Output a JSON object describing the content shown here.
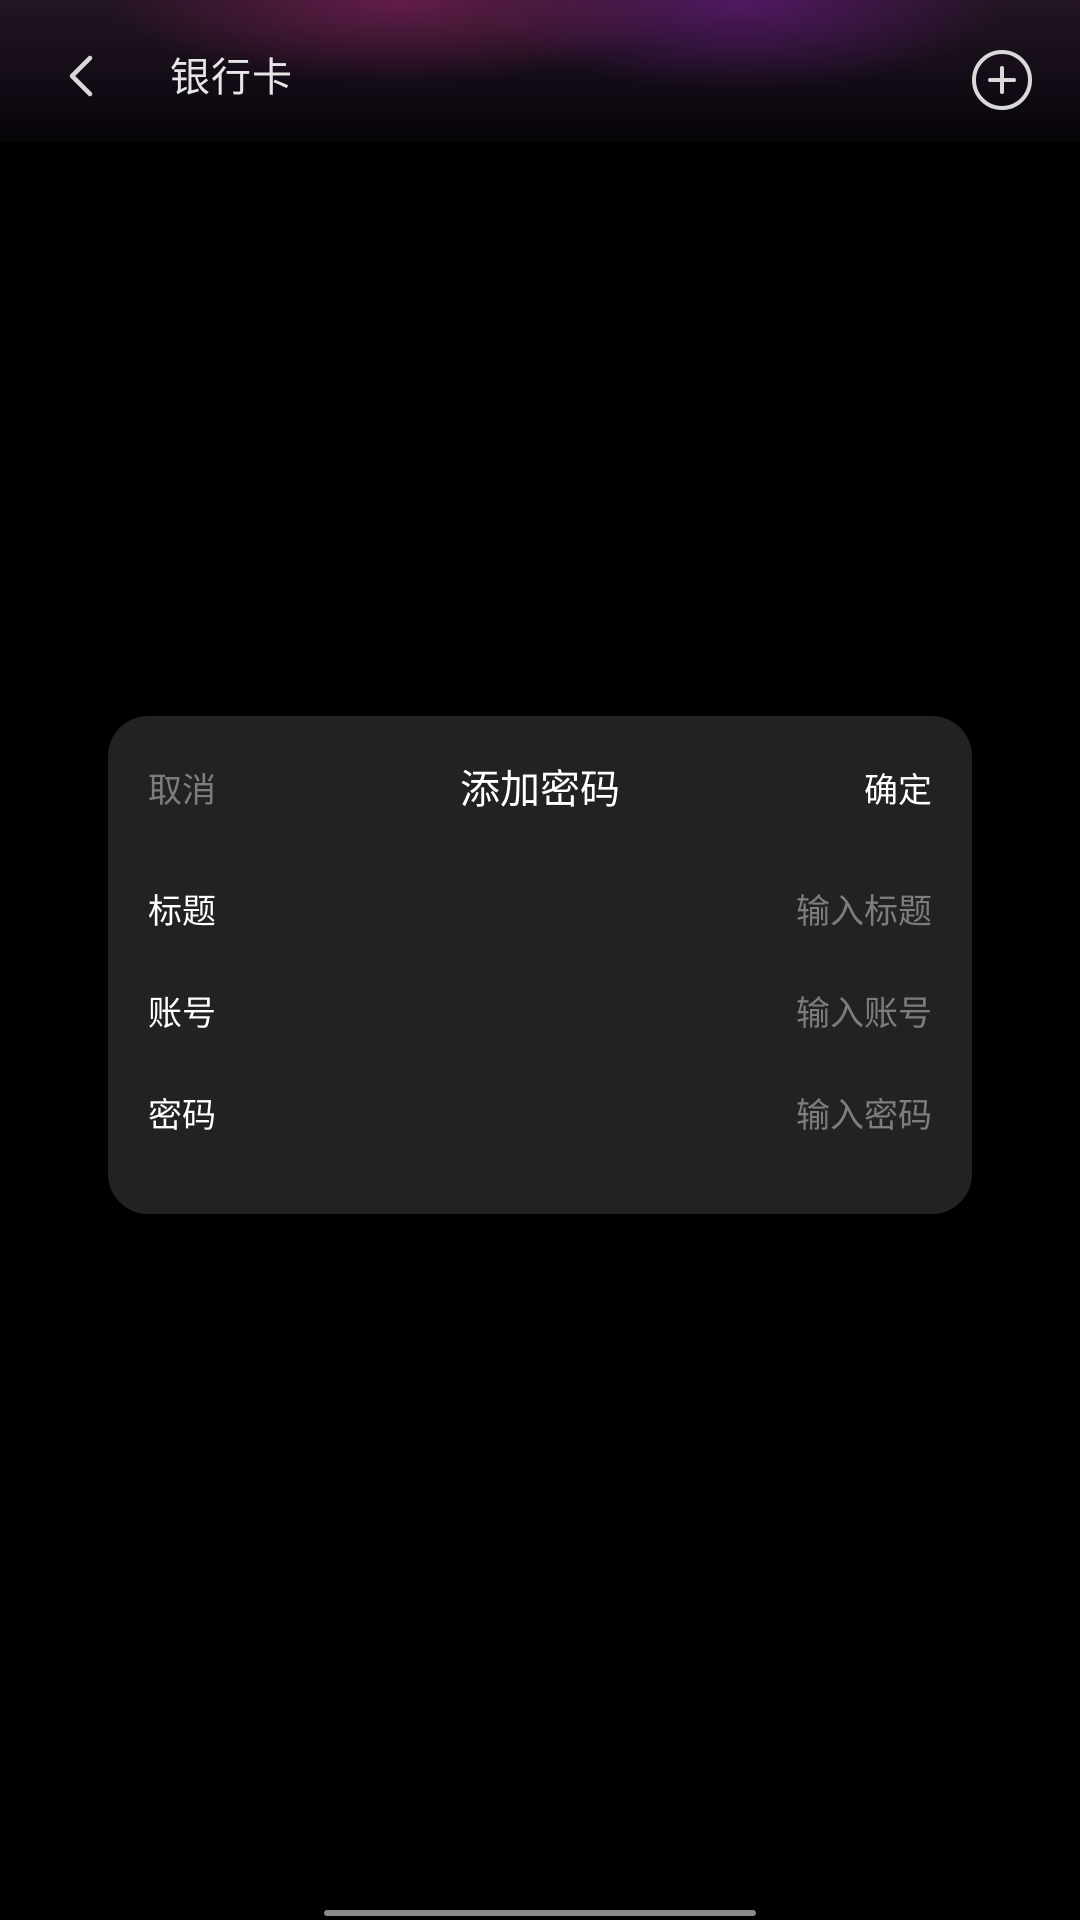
{
  "header": {
    "title": "银行卡",
    "back_icon": "chevron-left-icon",
    "add_icon": "plus-circle-icon"
  },
  "dialog": {
    "cancel_label": "取消",
    "title": "添加密码",
    "confirm_label": "确定",
    "fields": [
      {
        "label": "标题",
        "placeholder": "输入标题",
        "value": ""
      },
      {
        "label": "账号",
        "placeholder": "输入账号",
        "value": ""
      },
      {
        "label": "密码",
        "placeholder": "输入密码",
        "value": ""
      }
    ]
  },
  "colors": {
    "background": "#000000",
    "dialog_background": "#222222",
    "primary_text": "#ffffff",
    "muted_text": "#7d7d7d"
  }
}
